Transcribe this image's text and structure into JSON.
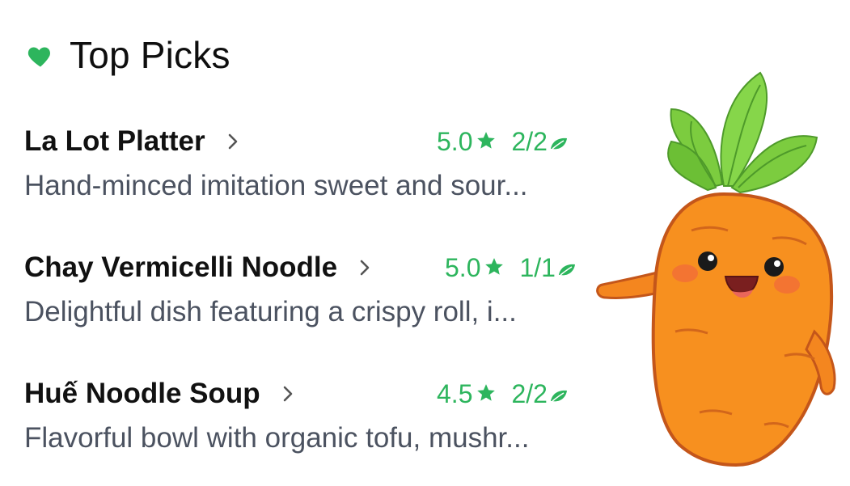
{
  "header": {
    "title": "Top Picks",
    "icon": "heart-icon",
    "icon_color": "#2db55d"
  },
  "accent_color": "#2db55d",
  "items": [
    {
      "name": "La Lot Platter",
      "rating": "5.0",
      "count": "2/2",
      "description": "Hand-minced imitation sweet and sour..."
    },
    {
      "name": "Chay Vermicelli Noodle",
      "rating": "5.0",
      "count": "1/1",
      "description": "Delightful dish featuring a crispy roll, i..."
    },
    {
      "name": "Huế Noodle Soup",
      "rating": "4.5",
      "count": "2/2",
      "description": "Flavorful bowl with organic tofu, mushr..."
    }
  ],
  "mascot": "carrot-mascot"
}
